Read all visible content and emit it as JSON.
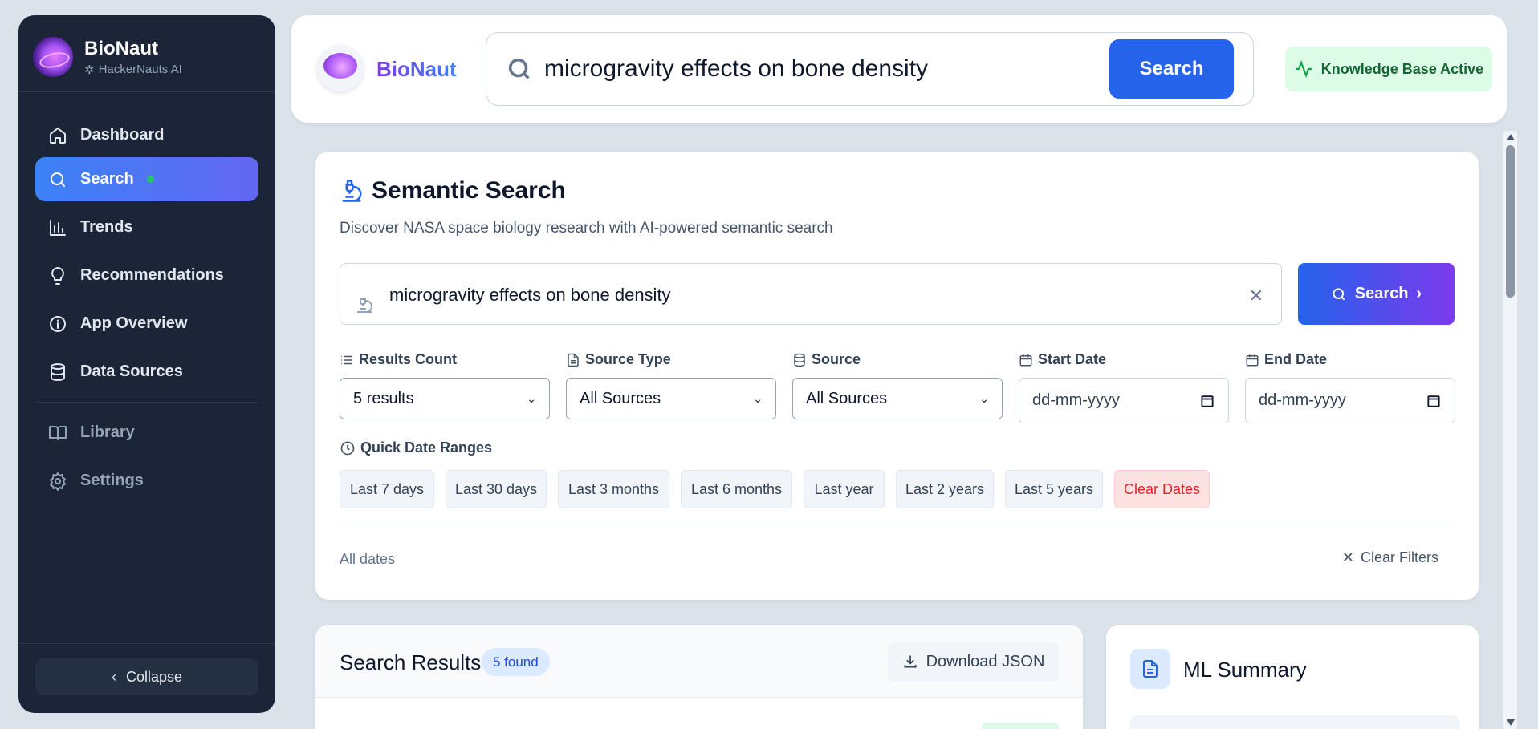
{
  "app": {
    "name": "BioNaut",
    "subtitle": "HackerNauts AI"
  },
  "sidebar": {
    "items": [
      {
        "label": "Dashboard",
        "icon": "home-icon"
      },
      {
        "label": "Search",
        "icon": "search-icon",
        "active": true
      },
      {
        "label": "Trends",
        "icon": "bar-chart-icon"
      },
      {
        "label": "Recommendations",
        "icon": "lightbulb-icon"
      },
      {
        "label": "App Overview",
        "icon": "info-icon"
      },
      {
        "label": "Data Sources",
        "icon": "database-icon"
      }
    ],
    "secondary": [
      {
        "label": "Library",
        "icon": "book-icon"
      },
      {
        "label": "Settings",
        "icon": "gear-icon"
      }
    ],
    "collapse_label": "Collapse"
  },
  "topbar": {
    "brand": "BioNaut",
    "query": "microgravity effects on bone density",
    "search_label": "Search",
    "status": "Knowledge Base Active"
  },
  "semantic": {
    "title": "Semantic Search",
    "subtitle": "Discover NASA space biology research with AI-powered semantic search",
    "query": "microgravity effects on bone density",
    "search_label": "Search",
    "filters": {
      "results_count": {
        "label": "Results Count",
        "value": "5 results"
      },
      "source_type": {
        "label": "Source Type",
        "value": "All Sources"
      },
      "source": {
        "label": "Source",
        "value": "All Sources"
      },
      "start_date": {
        "label": "Start Date",
        "placeholder": "dd-mm-yyyy"
      },
      "end_date": {
        "label": "End Date",
        "placeholder": "dd-mm-yyyy"
      }
    },
    "quick_label": "Quick Date Ranges",
    "quick_ranges": [
      "Last 7 days",
      "Last 30 days",
      "Last 3 months",
      "Last 6 months",
      "Last year",
      "Last 2 years",
      "Last 5 years"
    ],
    "clear_dates": "Clear Dates",
    "date_status": "All dates",
    "clear_filters": "Clear Filters"
  },
  "results": {
    "title": "Search Results",
    "count": "5 found",
    "download_label": "Download JSON"
  },
  "ml": {
    "title": "ML Summary"
  },
  "colors": {
    "accent": "#2563eb",
    "sidebar": "#1c2537",
    "success": "#16a34a",
    "danger": "#dc2626"
  }
}
